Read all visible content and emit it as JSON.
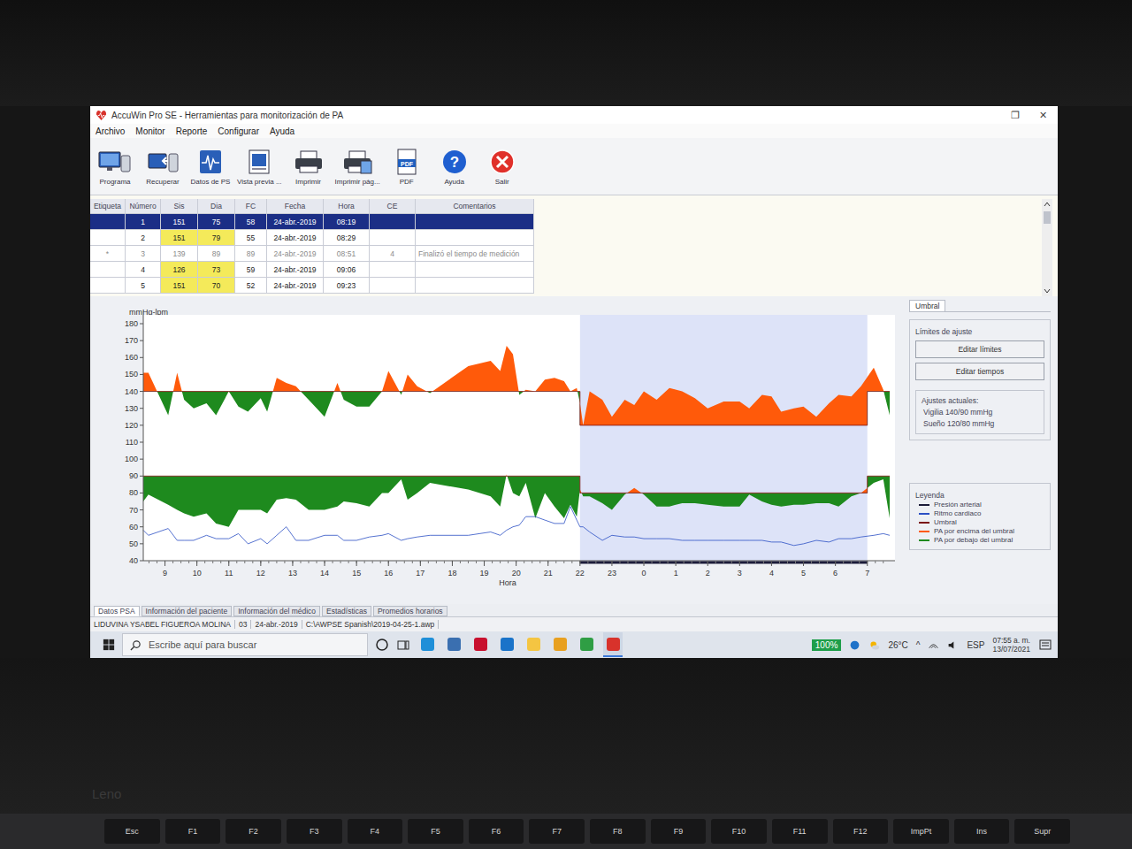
{
  "window": {
    "title": "AccuWin Pro SE - Herramientas para monitorización de PA",
    "controls": [
      "❐",
      "✕"
    ]
  },
  "menu": [
    "Archivo",
    "Monitor",
    "Reporte",
    "Configurar",
    "Ayuda"
  ],
  "toolbar": [
    {
      "label": "Programa",
      "kind": "monitor",
      "icon_text": ""
    },
    {
      "label": "Recuperar",
      "kind": "recover",
      "icon_text": ""
    },
    {
      "label": "Datos de PS",
      "kind": "wave",
      "icon_text": ""
    },
    {
      "label": "Vista previa ...",
      "kind": "preview",
      "icon_text": ""
    },
    {
      "label": "Imprimir",
      "kind": "print",
      "icon_text": ""
    },
    {
      "label": "Imprimir pág...",
      "kind": "printpage",
      "icon_text": ""
    },
    {
      "label": "PDF",
      "kind": "pdf",
      "icon_text": "PDF"
    },
    {
      "label": "Ayuda",
      "kind": "help",
      "icon_text": "?"
    },
    {
      "label": "Salir",
      "kind": "exit",
      "icon_text": ""
    }
  ],
  "table": {
    "columns": [
      "Etiqueta",
      "Número",
      "Sis",
      "Dia",
      "FC",
      "Fecha",
      "Hora",
      "CE",
      "Comentarios"
    ],
    "rows": [
      {
        "selected": true,
        "excluded": false,
        "cells": [
          {
            "text": "",
            "highlight": false
          },
          {
            "text": "1",
            "highlight": false
          },
          {
            "text": "151",
            "highlight": false
          },
          {
            "text": "75",
            "highlight": false
          },
          {
            "text": "58",
            "highlight": false
          },
          {
            "text": "24-abr.-2019",
            "highlight": false
          },
          {
            "text": "08:19",
            "highlight": false
          },
          {
            "text": "",
            "highlight": false
          },
          {
            "text": "",
            "highlight": false
          }
        ]
      },
      {
        "selected": false,
        "excluded": false,
        "cells": [
          {
            "text": "",
            "highlight": false
          },
          {
            "text": "2",
            "highlight": false
          },
          {
            "text": "151",
            "highlight": true
          },
          {
            "text": "79",
            "highlight": true
          },
          {
            "text": "55",
            "highlight": false
          },
          {
            "text": "24-abr.-2019",
            "highlight": false
          },
          {
            "text": "08:29",
            "highlight": false
          },
          {
            "text": "",
            "highlight": false
          },
          {
            "text": "",
            "highlight": false
          }
        ]
      },
      {
        "selected": false,
        "excluded": true,
        "cells": [
          {
            "text": "*",
            "highlight": false
          },
          {
            "text": "3",
            "highlight": false
          },
          {
            "text": "139",
            "highlight": false
          },
          {
            "text": "89",
            "highlight": false
          },
          {
            "text": "89",
            "highlight": false
          },
          {
            "text": "24-abr.-2019",
            "highlight": false
          },
          {
            "text": "08:51",
            "highlight": false
          },
          {
            "text": "4",
            "highlight": false
          },
          {
            "text": "Finalizó el tiempo de medición",
            "highlight": false
          }
        ]
      },
      {
        "selected": false,
        "excluded": false,
        "cells": [
          {
            "text": "",
            "highlight": false
          },
          {
            "text": "4",
            "highlight": false
          },
          {
            "text": "126",
            "highlight": true
          },
          {
            "text": "73",
            "highlight": true
          },
          {
            "text": "59",
            "highlight": false
          },
          {
            "text": "24-abr.-2019",
            "highlight": false
          },
          {
            "text": "09:06",
            "highlight": false
          },
          {
            "text": "",
            "highlight": false
          },
          {
            "text": "",
            "highlight": false
          }
        ]
      },
      {
        "selected": false,
        "excluded": false,
        "cells": [
          {
            "text": "",
            "highlight": false
          },
          {
            "text": "5",
            "highlight": false
          },
          {
            "text": "151",
            "highlight": true
          },
          {
            "text": "70",
            "highlight": true
          },
          {
            "text": "52",
            "highlight": false
          },
          {
            "text": "24-abr.-2019",
            "highlight": false
          },
          {
            "text": "09:23",
            "highlight": false
          },
          {
            "text": "",
            "highlight": false
          },
          {
            "text": "",
            "highlight": false
          }
        ]
      }
    ]
  },
  "chart": {
    "y_label": "mmHg-lpm",
    "x_label": "Hora",
    "y_ticks": [
      "180",
      "170",
      "160",
      "150",
      "140",
      "130",
      "120",
      "110",
      "100",
      "90",
      "80",
      "70",
      "60",
      "50",
      "40"
    ],
    "x_ticks": [
      "9",
      "10",
      "11",
      "12",
      "13",
      "14",
      "15",
      "16",
      "17",
      "18",
      "19",
      "20",
      "21",
      "22",
      "23",
      "0",
      "1",
      "2",
      "3",
      "4",
      "5",
      "6",
      "7"
    ],
    "thresholds": {
      "day": {
        "systolic": 140,
        "diastolic": 90
      },
      "night": {
        "systolic": 120,
        "diastolic": 80
      },
      "sleep_start": 22,
      "sleep_end": 31
    },
    "hours": [
      8.32,
      8.48,
      9.1,
      9.38,
      9.6,
      9.9,
      10.3,
      10.6,
      11.0,
      11.3,
      11.6,
      12.0,
      12.2,
      12.5,
      12.8,
      13.1,
      13.5,
      14.0,
      14.4,
      14.6,
      15.0,
      15.4,
      15.8,
      16.0,
      16.4,
      16.6,
      16.9,
      17.3,
      18.5,
      19.2,
      19.5,
      19.7,
      19.9,
      20.1,
      20.3,
      20.6,
      20.9,
      21.2,
      21.5,
      21.7,
      21.9,
      22.0,
      22.1,
      22.3,
      22.7,
      23.0,
      23.4,
      23.7,
      24.0,
      24.4,
      24.8,
      25.2,
      25.6,
      26.0,
      26.5,
      27.0,
      27.3,
      27.7,
      28.0,
      28.3,
      28.7,
      29.0,
      29.4,
      29.8,
      30.1,
      30.5,
      30.8,
      31.2,
      31.5,
      31.7
    ],
    "systolic": [
      151,
      151,
      126,
      151,
      135,
      130,
      133,
      126,
      140,
      131,
      128,
      136,
      128,
      148,
      145,
      143,
      135,
      125,
      145,
      135,
      131,
      131,
      140,
      152,
      138,
      150,
      143,
      139,
      155,
      158,
      152,
      167,
      162,
      138,
      141,
      140,
      147,
      148,
      146,
      140,
      142,
      133,
      120,
      140,
      135,
      125,
      135,
      132,
      140,
      135,
      142,
      140,
      136,
      130,
      134,
      134,
      130,
      138,
      137,
      128,
      130,
      131,
      125,
      133,
      138,
      137,
      143,
      154,
      141,
      126
    ],
    "diastolic": [
      75,
      79,
      73,
      70,
      68,
      66,
      68,
      62,
      60,
      70,
      70,
      70,
      68,
      76,
      77,
      76,
      70,
      70,
      72,
      75,
      74,
      72,
      80,
      80,
      88,
      76,
      80,
      86,
      82,
      78,
      72,
      91,
      80,
      78,
      86,
      65,
      80,
      72,
      65,
      73,
      66,
      82,
      78,
      78,
      74,
      70,
      79,
      83,
      79,
      72,
      72,
      74,
      74,
      73,
      72,
      72,
      79,
      75,
      73,
      72,
      73,
      73,
      74,
      74,
      72,
      78,
      80,
      86,
      88,
      65
    ],
    "heart_rate": [
      58,
      55,
      59,
      52,
      52,
      52,
      55,
      53,
      53,
      56,
      50,
      53,
      50,
      55,
      60,
      52,
      52,
      55,
      55,
      52,
      52,
      54,
      55,
      56,
      52,
      53,
      54,
      55,
      55,
      57,
      55,
      58,
      60,
      61,
      66,
      66,
      64,
      62,
      62,
      72,
      64,
      60,
      60,
      57,
      52,
      55,
      54,
      54,
      53,
      53,
      53,
      52,
      52,
      52,
      52,
      52,
      52,
      52,
      51,
      51,
      49,
      50,
      52,
      51,
      53,
      53,
      54,
      55,
      56,
      55
    ]
  },
  "side_panel": {
    "tab": "Umbral",
    "group_title": "Límites de ajuste",
    "buttons": [
      "Editar límites",
      "Editar tiempos"
    ],
    "settings_title": "Ajustes actuales:",
    "settings": [
      "Vigilia 140/90 mmHg",
      "Sueño 120/80 mmHg"
    ],
    "legend_title": "Leyenda",
    "legend": [
      {
        "label": "Presión arterial",
        "color": "#1c1c3a"
      },
      {
        "label": "Ritmo cardiaco",
        "color": "#2b4fc4"
      },
      {
        "label": "Umbral",
        "color": "#7a1010"
      },
      {
        "label": "PA por encima del umbral",
        "color": "#ff5a0a"
      },
      {
        "label": "PA por debajo del umbral",
        "color": "#1e8a1e"
      }
    ]
  },
  "bottom_tabs": [
    {
      "label": "Datos PSA",
      "selected": true
    },
    {
      "label": "Información del paciente",
      "selected": false
    },
    {
      "label": "Información del médico",
      "selected": false
    },
    {
      "label": "Estadísticas",
      "selected": false
    },
    {
      "label": "Promedios horarios",
      "selected": false
    }
  ],
  "status_bar": [
    "LIDUVINA YSABEL FIGUEROA MOLINA",
    "03",
    "24-abr.-2019",
    "C:\\AWPSE Spanish\\2019-04-25-1.awp"
  ],
  "taskbar": {
    "search_placeholder": "Escribe aquí para buscar",
    "apps": [
      {
        "color": "#1f8fd8",
        "active": false
      },
      {
        "color": "#3a6fb0",
        "active": false
      },
      {
        "color": "#c8102e",
        "active": false
      },
      {
        "color": "#1a73c9",
        "active": false
      },
      {
        "color": "#f4c542",
        "active": false
      },
      {
        "color": "#e8a020",
        "active": false
      },
      {
        "color": "#2f9e44",
        "active": false
      },
      {
        "color": "#d8322b",
        "active": true
      }
    ],
    "battery": "100%",
    "weather": "26°C",
    "tray_arrow": "^",
    "language": "ESP",
    "time": "07:55 a. m.",
    "date": "13/07/2021"
  },
  "bezel_logo": "Leno",
  "keys": [
    "Esc",
    "F1",
    "F2",
    "F3",
    "F4",
    "F5",
    "F6",
    "F7",
    "F8",
    "F9",
    "F10",
    "F11",
    "F12",
    "ImpPt",
    "Ins",
    "Supr"
  ]
}
